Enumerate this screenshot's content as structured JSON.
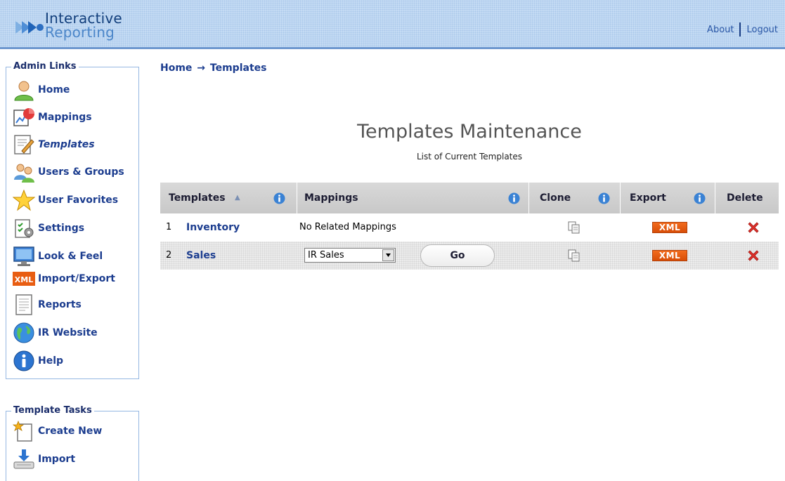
{
  "app": {
    "logo_line1": "Interactive",
    "logo_line2": "Reporting"
  },
  "header": {
    "about": "About",
    "logout": "Logout"
  },
  "admin_links": {
    "legend": "Admin Links",
    "items": [
      {
        "label": "Home",
        "icon": "user-icon"
      },
      {
        "label": "Mappings",
        "icon": "mappings-icon"
      },
      {
        "label": "Templates",
        "icon": "templates-icon",
        "active": true
      },
      {
        "label": "Users & Groups",
        "icon": "users-groups-icon"
      },
      {
        "label": "User Favorites",
        "icon": "star-icon"
      },
      {
        "label": "Settings",
        "icon": "settings-icon"
      },
      {
        "label": "Look & Feel",
        "icon": "monitor-icon"
      },
      {
        "label": "Import/Export",
        "icon": "xml-icon",
        "icon_text": "XML"
      },
      {
        "label": "Reports",
        "icon": "report-icon"
      },
      {
        "label": "IR Website",
        "icon": "globe-icon"
      },
      {
        "label": "Help",
        "icon": "info-icon"
      }
    ]
  },
  "template_tasks": {
    "legend": "Template Tasks",
    "items": [
      {
        "label": "Create New",
        "icon": "new-document-icon"
      },
      {
        "label": "Import",
        "icon": "import-icon"
      }
    ]
  },
  "breadcrumb": {
    "home": "Home",
    "arrow": "→",
    "current": "Templates"
  },
  "main": {
    "title": "Templates Maintenance",
    "subtitle": "List of Current Templates"
  },
  "table": {
    "headers": {
      "templates": "Templates",
      "mappings": "Mappings",
      "clone": "Clone",
      "export": "Export",
      "delete": "Delete"
    },
    "sort_indicator": "▲",
    "rows": [
      {
        "num": "1",
        "name": "Inventory",
        "mapping_text": "No Related Mappings",
        "export": "XML"
      },
      {
        "num": "2",
        "name": "Sales",
        "mapping_select": "IR Sales",
        "go": "Go",
        "export": "XML"
      }
    ]
  },
  "colors": {
    "link": "#1c3d8f",
    "header_bg": "#c6dcf4",
    "xml_badge": "#e85d12",
    "delete_red": "#e0302a"
  }
}
